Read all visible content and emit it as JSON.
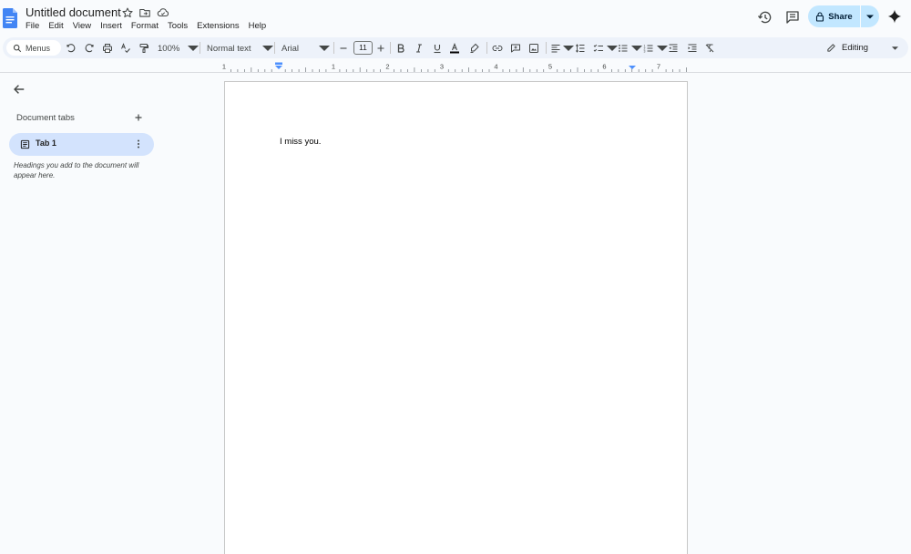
{
  "document": {
    "title": "Untitled document",
    "body_text": "I miss you."
  },
  "menu": [
    "File",
    "Edit",
    "View",
    "Insert",
    "Format",
    "Tools",
    "Extensions",
    "Help"
  ],
  "header": {
    "share_label": "Share"
  },
  "toolbar": {
    "menus_search_label": "Menus",
    "zoom": "100%",
    "paragraph_style": "Normal text",
    "font": "Arial",
    "font_size": "11",
    "mode": "Editing"
  },
  "ruler": {
    "labels": [
      "1",
      "1",
      "2",
      "3",
      "4",
      "5",
      "6",
      "7"
    ]
  },
  "sidebar": {
    "section_title": "Document tabs",
    "tabs": [
      {
        "label": "Tab 1"
      }
    ],
    "hint": "Headings you add to the document will appear here."
  },
  "colors": {
    "accent": "#0b57d0",
    "share_bg": "#c2e7ff",
    "tab_active_bg": "#d3e3fd",
    "toolbar_bg": "#edf2fa",
    "docs_blue": "#4285f4"
  }
}
